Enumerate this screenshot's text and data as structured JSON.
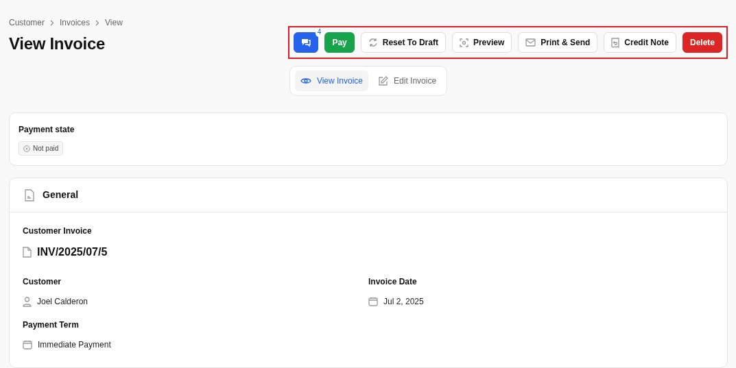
{
  "breadcrumb": [
    "Customer",
    "Invoices",
    "View"
  ],
  "title": "View Invoice",
  "actions": {
    "highlighted": true,
    "buttons": [
      {
        "kind": "chat",
        "badge": "4"
      },
      {
        "kind": "pay",
        "label": "Pay"
      },
      {
        "kind": "reset",
        "label": "Reset To Draft"
      },
      {
        "kind": "preview",
        "label": "Preview"
      },
      {
        "kind": "mail",
        "label": "Print & Send"
      },
      {
        "kind": "credit",
        "label": "Credit Note"
      },
      {
        "kind": "delete",
        "label": "Delete"
      }
    ]
  },
  "tabs": [
    {
      "label": "View Invoice",
      "kind": "view",
      "selected": true
    },
    {
      "label": "Edit Invoice",
      "kind": "edit",
      "selected": false
    }
  ],
  "payment_state": {
    "label": "Payment state",
    "badge": "Not paid",
    "paid": false
  },
  "general": {
    "title": "General",
    "invoice_label": "Customer Invoice",
    "invoice_number": "INV/2025/07/5",
    "fields": [
      {
        "label": "Customer",
        "value": "Joel Calderon",
        "kind": "person"
      },
      {
        "label": "Invoice Date",
        "value": "Jul 2, 2025",
        "kind": "date"
      },
      {
        "label": "Payment Term",
        "value": "Immediate Payment",
        "kind": "date"
      }
    ]
  }
}
